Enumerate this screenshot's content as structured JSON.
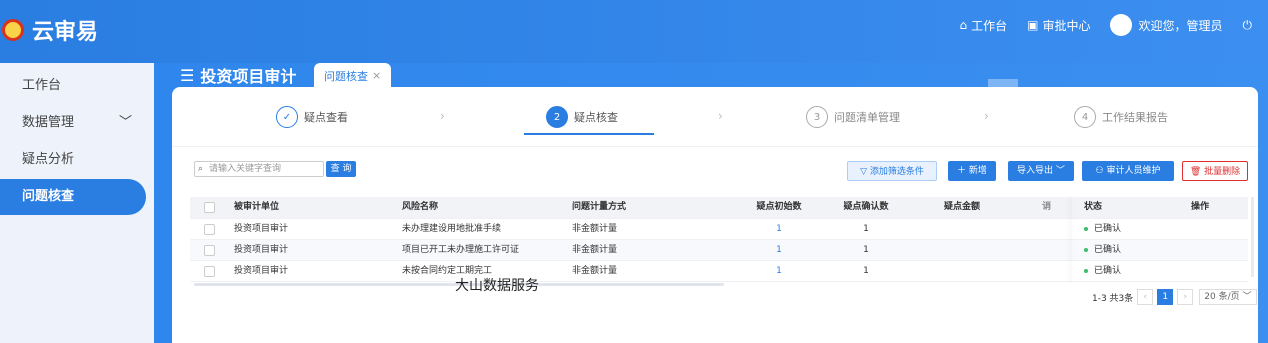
{
  "brand": {
    "name": "云审易"
  },
  "topnav": {
    "workbench": "工作台",
    "approval": "审批中心",
    "welcome": "欢迎您，管理员"
  },
  "sidebar": {
    "items": [
      {
        "label": "工作台"
      },
      {
        "label": "数据管理",
        "caret": "﹀"
      },
      {
        "label": "疑点分析"
      },
      {
        "label": "问题核查"
      }
    ]
  },
  "page": {
    "title": "投资项目审计",
    "tab": "问题核查",
    "tab_close": "×"
  },
  "steps": [
    {
      "index": "✓",
      "label": "疑点查看"
    },
    {
      "index": "2",
      "label": "疑点核查"
    },
    {
      "index": "3",
      "label": "问题清单管理"
    },
    {
      "index": "4",
      "label": "工作结果报告"
    }
  ],
  "toolbar": {
    "search_placeholder": "请输入关键字查询",
    "search_btn": "查 询",
    "filter": "添加筛选条件",
    "add": "新增",
    "io": "导入导出",
    "auditor": "审计人员维护",
    "batch_delete": "批量删除"
  },
  "table": {
    "headers": {
      "unit": "被审计单位",
      "risk": "风险名称",
      "method": "问题计量方式",
      "init": "疑点初始数",
      "conf": "疑点确认数",
      "amount": "疑点金额",
      "trunc": "诮",
      "status": "状态",
      "op": "操作"
    },
    "rows": [
      {
        "unit": "投资项目审计",
        "risk": "未办理建设用地批准手续",
        "method": "非金额计量",
        "init": "1",
        "conf": "1",
        "status": "已确认"
      },
      {
        "unit": "投资项目审计",
        "risk": "项目已开工未办理施工许可证",
        "method": "非金额计量",
        "init": "1",
        "conf": "1",
        "status": "已确认"
      },
      {
        "unit": "投资项目审计",
        "risk": "未按合同约定工期完工",
        "method": "非金额计量",
        "init": "1",
        "conf": "1",
        "status": "已确认"
      }
    ]
  },
  "watermark": "大山数据服务",
  "pager": {
    "summary": "1-3 共3条",
    "page": "1",
    "size": "20 条/页"
  },
  "colors": {
    "primary": "#2a7de1",
    "danger": "#e02f2f",
    "success": "#3bbd6a"
  }
}
